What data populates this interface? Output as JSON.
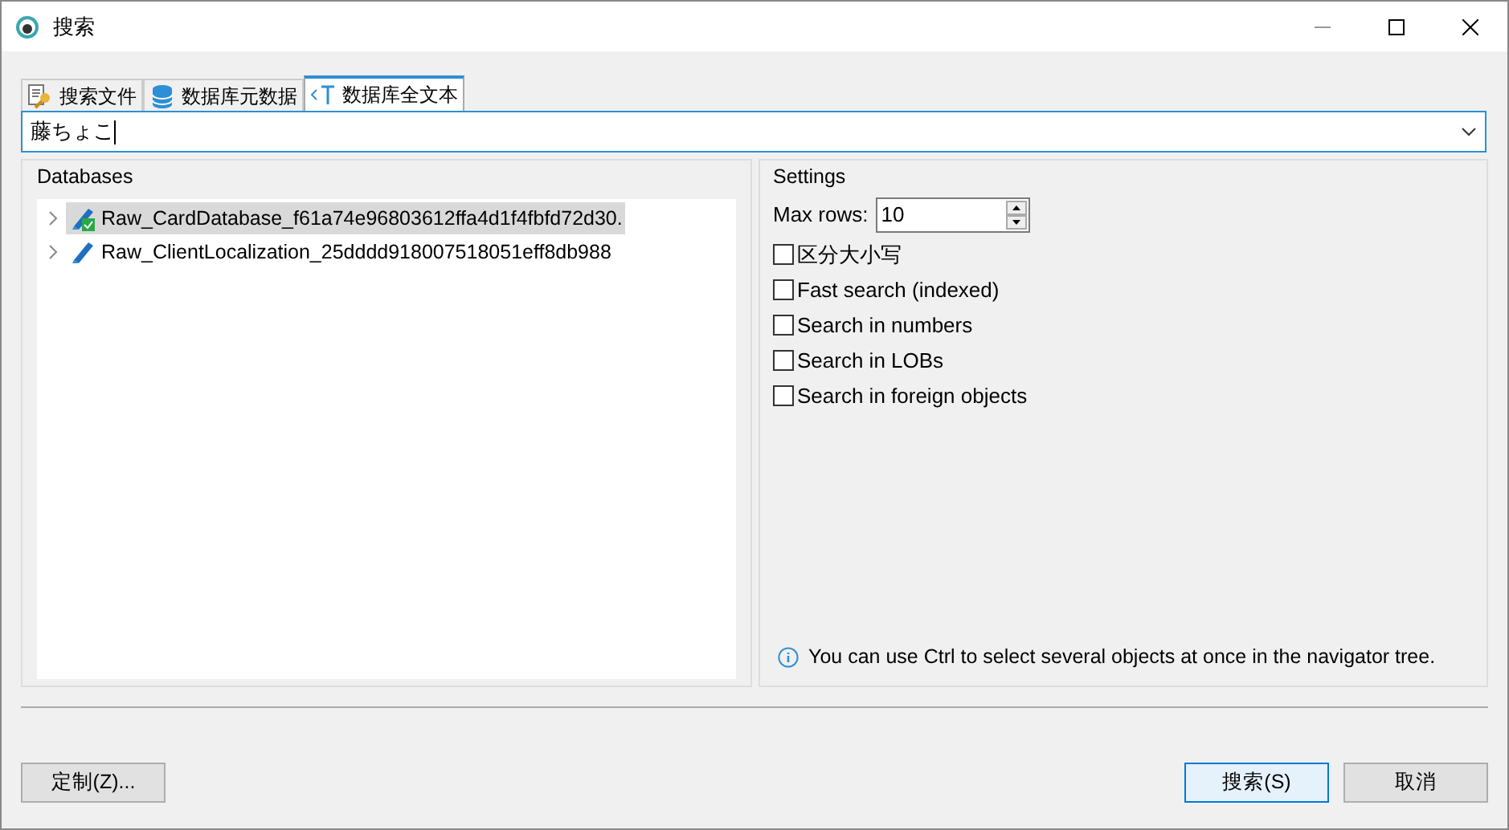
{
  "window": {
    "title": "搜索"
  },
  "tabs": [
    {
      "label": "搜索文件",
      "selected": false,
      "kind": "files"
    },
    {
      "label": "数据库元数据",
      "selected": false,
      "kind": "metadata"
    },
    {
      "label": "数据库全文本",
      "selected": true,
      "kind": "fulltext"
    }
  ],
  "search": {
    "value": "藤ちょこ"
  },
  "databases": {
    "title": "Databases",
    "items": [
      {
        "name": "Raw_CardDatabase_f61a74e96803612ffa4d1f4fbfd72d30.",
        "selected": true,
        "connected": true
      },
      {
        "name": "Raw_ClientLocalization_25dddd918007518051eff8db988",
        "selected": false,
        "connected": false
      }
    ]
  },
  "settings": {
    "title": "Settings",
    "max_rows_label": "Max rows:",
    "max_rows": "10",
    "options": [
      {
        "label": "区分大小写",
        "checked": false
      },
      {
        "label": "Fast search (indexed)",
        "checked": false
      },
      {
        "label": "Search in numbers",
        "checked": false
      },
      {
        "label": "Search in LOBs",
        "checked": false
      },
      {
        "label": "Search in foreign objects",
        "checked": false
      }
    ],
    "hint": "You can use Ctrl to select several objects at once in the navigator tree."
  },
  "buttons": {
    "customize": "定制(Z)...",
    "search": "搜索(S)",
    "cancel": "取消"
  }
}
